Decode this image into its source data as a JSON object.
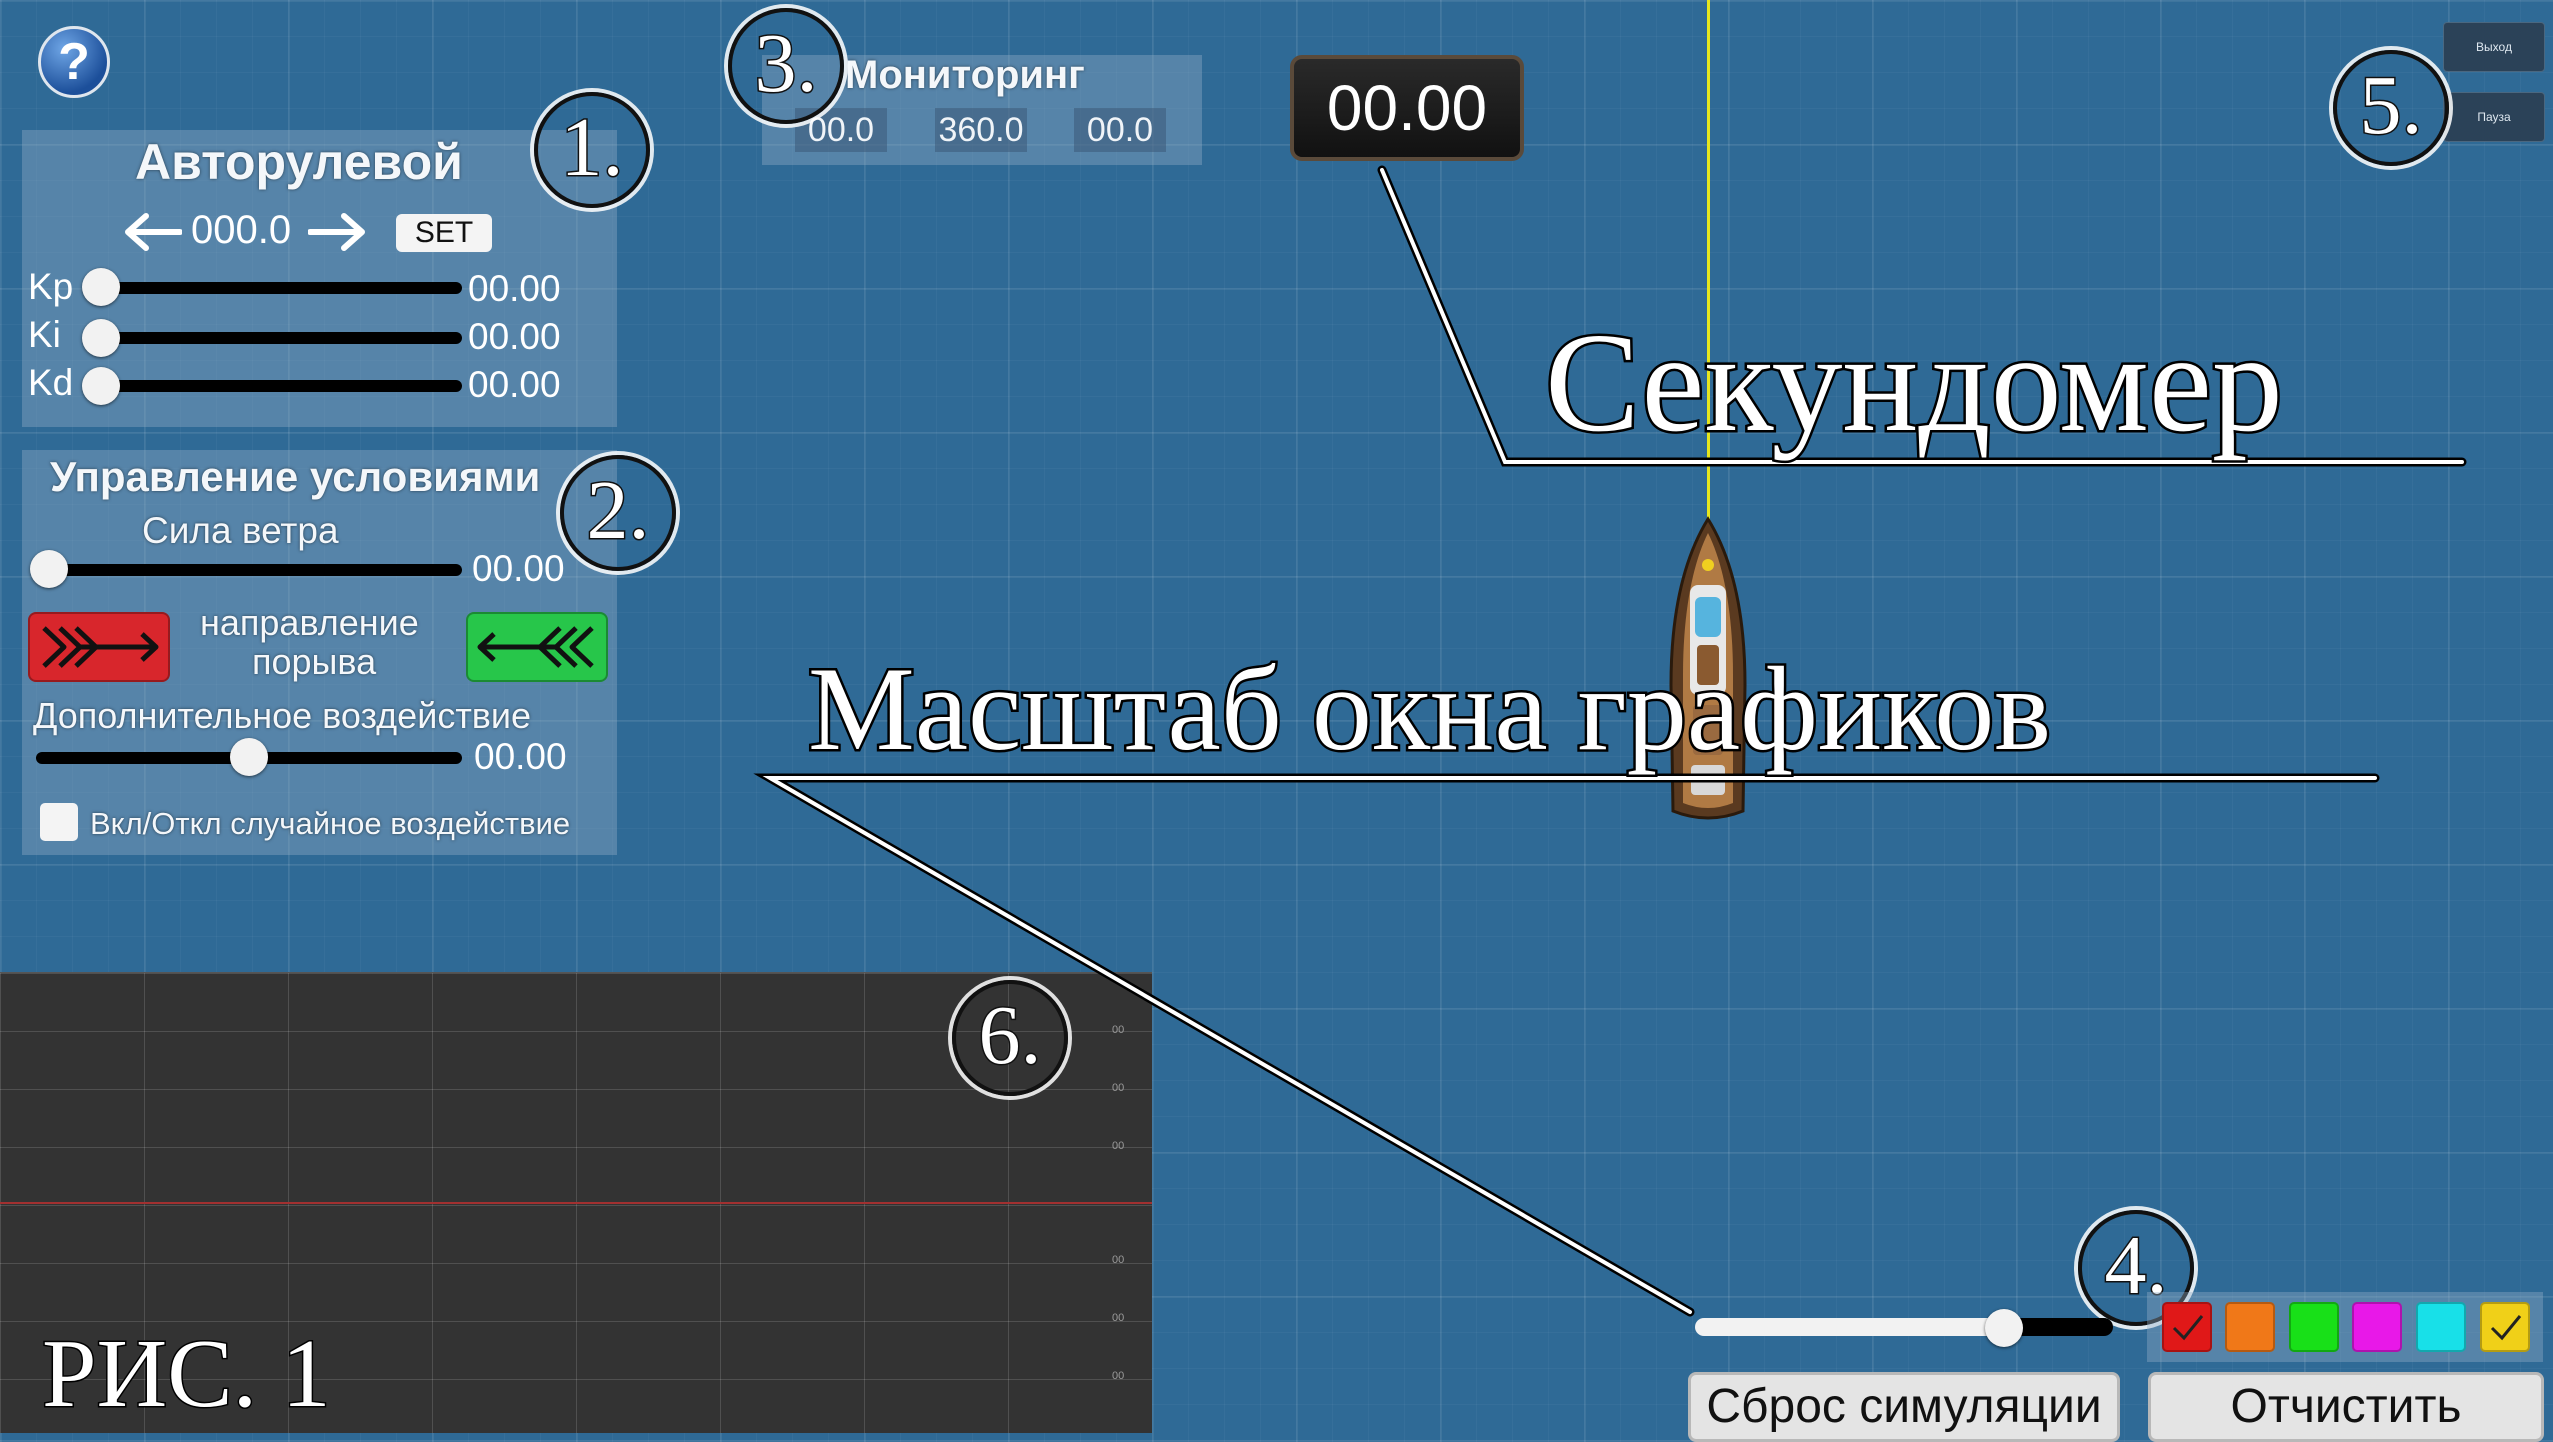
{
  "help": {
    "label": "?"
  },
  "autopilot": {
    "title": "Авторулевой",
    "heading_value": "000.0",
    "set_label": "SET",
    "sliders": [
      {
        "label": "Kp",
        "value": "00.00",
        "fraction": 0.0
      },
      {
        "label": "Ki",
        "value": "00.00",
        "fraction": 0.0
      },
      {
        "label": "Kd",
        "value": "00.00",
        "fraction": 0.0
      }
    ]
  },
  "conditions": {
    "title": "Управление условиями",
    "wind_label": "Сила ветра",
    "wind_value": "00.00",
    "wind_fraction": 0.0,
    "gust_label_1": "направление",
    "gust_label_2": "порыва",
    "extra_label": "Дополнительное воздействие",
    "extra_value": "00.00",
    "extra_fraction": 0.5,
    "random_label": "Вкл/Откл случайное воздействие",
    "random_checked": false,
    "colors": {
      "left_btn": "#d8262c",
      "right_btn": "#27c64a"
    }
  },
  "monitoring": {
    "title": "Мониторинг",
    "values": [
      "00.0",
      "360.0",
      "00.0"
    ]
  },
  "stopwatch": {
    "value": "00.00"
  },
  "top_buttons": {
    "exit": "Выход",
    "pause": "Пауза"
  },
  "annotations": {
    "n1": "1.",
    "n2": "2.",
    "n3": "3.",
    "n4": "4.",
    "n5": "5.",
    "n6": "6.",
    "stopwatch_label": "Секундомер",
    "scale_label": "Масштаб окна графиков",
    "figure_label": "РИС. 1"
  },
  "graph": {
    "tick_labels": [
      "00",
      "00",
      "00",
      "00",
      "00",
      "00"
    ]
  },
  "scale": {
    "fraction": 0.85
  },
  "palette": {
    "colors": [
      "#e01818",
      "#f07818",
      "#18e018",
      "#e818e8",
      "#18e0e8",
      "#f0d018"
    ],
    "checked": [
      true,
      false,
      false,
      false,
      false,
      true
    ]
  },
  "bottom_buttons": {
    "reset": "Сброс симуляции",
    "clear": "Отчистить"
  }
}
